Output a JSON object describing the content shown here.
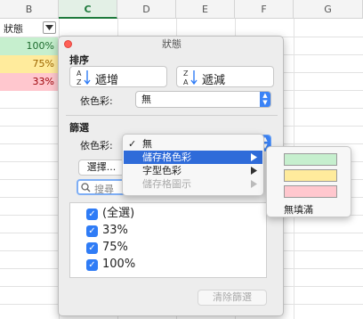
{
  "sheet": {
    "columns": [
      "B",
      "C",
      "D",
      "E",
      "F",
      "G"
    ],
    "header_cell": "狀態",
    "values": [
      "100%",
      "75%",
      "33%"
    ],
    "colors": {
      "green": "#c6efce",
      "yellow": "#ffeb9c",
      "red": "#ffc7ce",
      "selected_col": "#1e7a3c"
    }
  },
  "dialog": {
    "title": "狀態",
    "sort": {
      "heading": "排序",
      "ascending": "遞增",
      "descending": "遞減",
      "by_color_label": "依色彩:",
      "by_color_value": "無"
    },
    "filter": {
      "heading": "篩選",
      "by_color_label": "依色彩:",
      "by_color_value": "無",
      "choose_button": "選擇...",
      "search_placeholder": "搜尋",
      "items": [
        {
          "label": "(全選)",
          "checked": true
        },
        {
          "label": "33%",
          "checked": true
        },
        {
          "label": "75%",
          "checked": true
        },
        {
          "label": "100%",
          "checked": true
        }
      ],
      "clear_button": "清除篩選"
    }
  },
  "color_menu": {
    "items": [
      {
        "label": "無",
        "checked": true,
        "enabled": true
      },
      {
        "label": "儲存格色彩",
        "highlighted": true,
        "enabled": true
      },
      {
        "label": "字型色彩",
        "enabled": true
      },
      {
        "label": "儲存格圖示",
        "enabled": false
      }
    ],
    "accent": "#2f6bd9"
  },
  "swatch_menu": {
    "swatches": [
      "#c6efce",
      "#ffeb9c",
      "#ffc7ce"
    ],
    "no_fill": "無填滿"
  }
}
